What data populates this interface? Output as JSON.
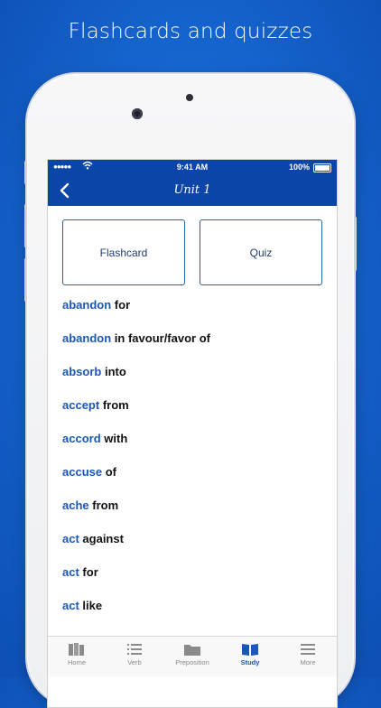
{
  "headline": "Flashcards and quizzes",
  "status": {
    "time": "9:41 AM",
    "battery": "100%"
  },
  "nav": {
    "title": "Unit 1"
  },
  "cards": {
    "flashcard": "Flashcard",
    "quiz": "Quiz"
  },
  "words": [
    {
      "verb": "abandon",
      "prep": "for"
    },
    {
      "verb": "abandon",
      "prep": "in favour/favor of"
    },
    {
      "verb": "absorb",
      "prep": "into"
    },
    {
      "verb": "accept",
      "prep": "from"
    },
    {
      "verb": "accord",
      "prep": "with"
    },
    {
      "verb": "accuse",
      "prep": "of"
    },
    {
      "verb": "ache",
      "prep": "from"
    },
    {
      "verb": "act",
      "prep": "against"
    },
    {
      "verb": "act",
      "prep": "for"
    },
    {
      "verb": "act",
      "prep": "like"
    }
  ],
  "tabs": [
    {
      "label": "Home",
      "icon": "books-icon"
    },
    {
      "label": "Verb",
      "icon": "list-icon"
    },
    {
      "label": "Preposition",
      "icon": "folder-icon"
    },
    {
      "label": "Study",
      "icon": "open-book-icon",
      "active": true
    },
    {
      "label": "More",
      "icon": "menu-icon"
    }
  ],
  "colors": {
    "accent": "#1a57b8",
    "navbar": "#0b45a8",
    "background": "#1666d0"
  }
}
